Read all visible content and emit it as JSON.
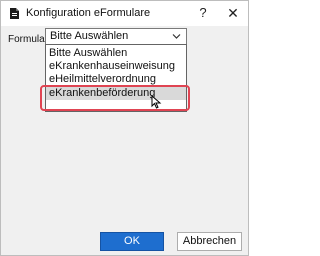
{
  "window": {
    "title": "Konfiguration eFormulare",
    "help_label": "?",
    "close_label": "✕"
  },
  "form": {
    "label": "Formular",
    "selected": "Bitte Auswählen",
    "options": [
      "Bitte Auswählen",
      "eKrankenhauseinweisung",
      "eHeilmittelverordnung",
      "eKrankenbeförderung"
    ],
    "highlighted_option": "eKrankenbeförderung"
  },
  "buttons": {
    "ok": "OK",
    "cancel": "Abbrechen"
  },
  "colors": {
    "highlight_box": "#e04452",
    "ok_button": "#1e6ecf"
  },
  "icons": [
    "app-icon",
    "chevron-down-icon",
    "mouse-cursor-icon"
  ]
}
